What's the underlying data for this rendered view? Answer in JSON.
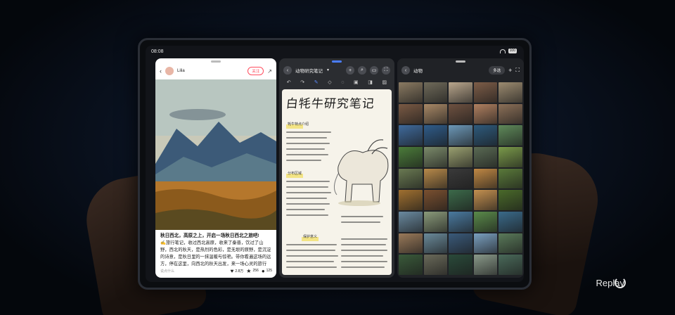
{
  "status_bar": {
    "time": "08:08",
    "battery": "100"
  },
  "pane1": {
    "username": "Lilia",
    "follow_label": "关注",
    "post_title": "秋日西北，高原之上，开启一场秋日西北之旅吧!",
    "post_body": "✍️旅行笔记，收过西北高原，收来了秦晋，饮过了山野，西北的秋天，是热烈的色彩，是无垠的原野，是沉淀的诗意，是秋日里的一抹温暖与惊艳。带你看遍这场的远方，停在这里，向西北的秋天出发，来一场心灵的旅行吧！",
    "comment_placeholder": "说点什么",
    "likes": "2.8万",
    "favorites": "256",
    "comments": "125"
  },
  "pane2": {
    "notebook_name": "动物研究笔记",
    "note_title": "白牦牛研究笔记",
    "section_labels": [
      "牦牛特点介绍",
      "分布区域",
      "保护意义"
    ]
  },
  "pane3": {
    "album_name": "动物",
    "select_label": "多选"
  },
  "replay_label": "Replay",
  "photo_colors": [
    "#8a7a62",
    "#6f6a5a",
    "#b9a68c",
    "#7d5d48",
    "#9c8b70",
    "#7a5a44",
    "#a88866",
    "#6e5140",
    "#b08060",
    "#8c7058",
    "#3f6a9c",
    "#2f5c8a",
    "#6c98b8",
    "#2e5a7c",
    "#5f8a5a",
    "#4b7c3a",
    "#7b8a6a",
    "#9aa070",
    "#5a6a54",
    "#7a9a4a",
    "#6a7a52",
    "#b88a4a",
    "#3a3a3a",
    "#c08844",
    "#5a7a3a",
    "#a07030",
    "#7a5030",
    "#3c6a4a",
    "#c49050",
    "#4a6a2a",
    "#6a8aa0",
    "#8a9a7a",
    "#4a7aa0",
    "#5a8a4a",
    "#3a6a8a",
    "#9a7a5a",
    "#6a8a9a",
    "#3a5a7a",
    "#7aa0c0",
    "#5a7a5a",
    "#3a5a3a",
    "#6a6a5a",
    "#2a4a3a",
    "#8a9a8a",
    "#4a6a5a"
  ]
}
